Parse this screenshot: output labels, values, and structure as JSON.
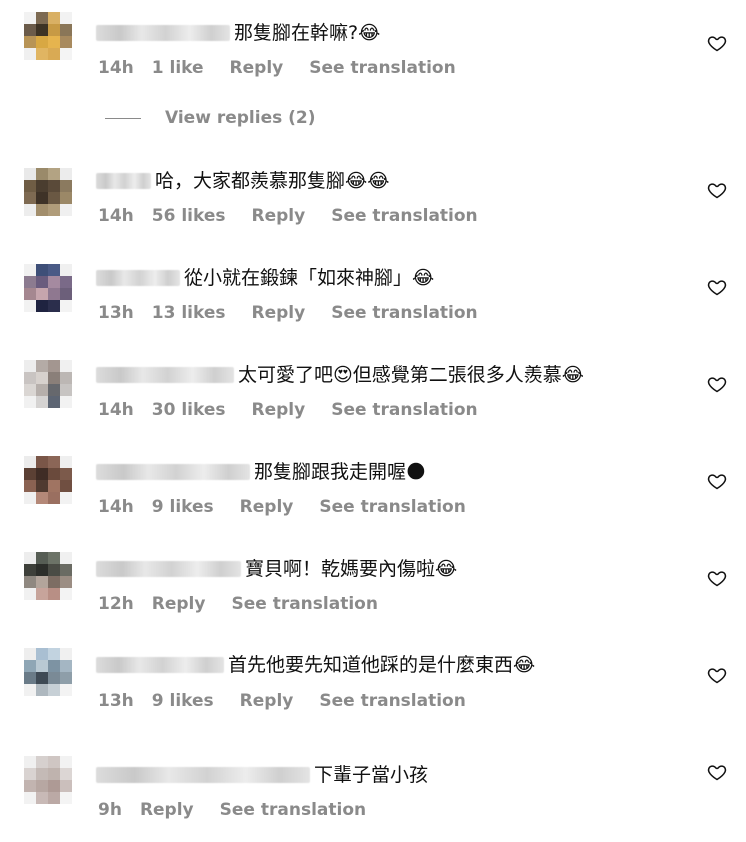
{
  "comments": [
    {
      "text": "那隻腳在幹嘛?😂",
      "time": "14h",
      "likes": "1 like",
      "reply": "Reply",
      "translate": "See translation"
    },
    {
      "text": "哈，大家都羨慕那隻腳😂😂",
      "time": "14h",
      "likes": "56 likes",
      "reply": "Reply",
      "translate": "See translation"
    },
    {
      "text": "從小就在鍛鍊「如來神腳」😂",
      "time": "13h",
      "likes": "13 likes",
      "reply": "Reply",
      "translate": "See translation"
    },
    {
      "text": "太可愛了吧😍但感覺第二張很多人羨慕😂",
      "time": "14h",
      "likes": "30 likes",
      "reply": "Reply",
      "translate": "See translation"
    },
    {
      "text": "那隻腳跟我走開喔🌑",
      "time": "14h",
      "likes": "9 likes",
      "reply": "Reply",
      "translate": "See translation"
    },
    {
      "text": "寶貝啊！乾媽要內傷啦😂",
      "time": "12h",
      "likes": "",
      "reply": "Reply",
      "translate": "See translation"
    },
    {
      "text": "首先他要先知道他踩的是什麼東西😂",
      "time": "13h",
      "likes": "9 likes",
      "reply": "Reply",
      "translate": "See translation"
    },
    {
      "text": "下輩子當小孩",
      "time": "9h",
      "likes": "",
      "reply": "Reply",
      "translate": "See translation"
    }
  ],
  "view_replies": "View replies (2)",
  "icons": {
    "like": "heart-outline-icon"
  },
  "colors": {
    "meta_text": "#8a8a8a",
    "comment_text": "#111111"
  }
}
